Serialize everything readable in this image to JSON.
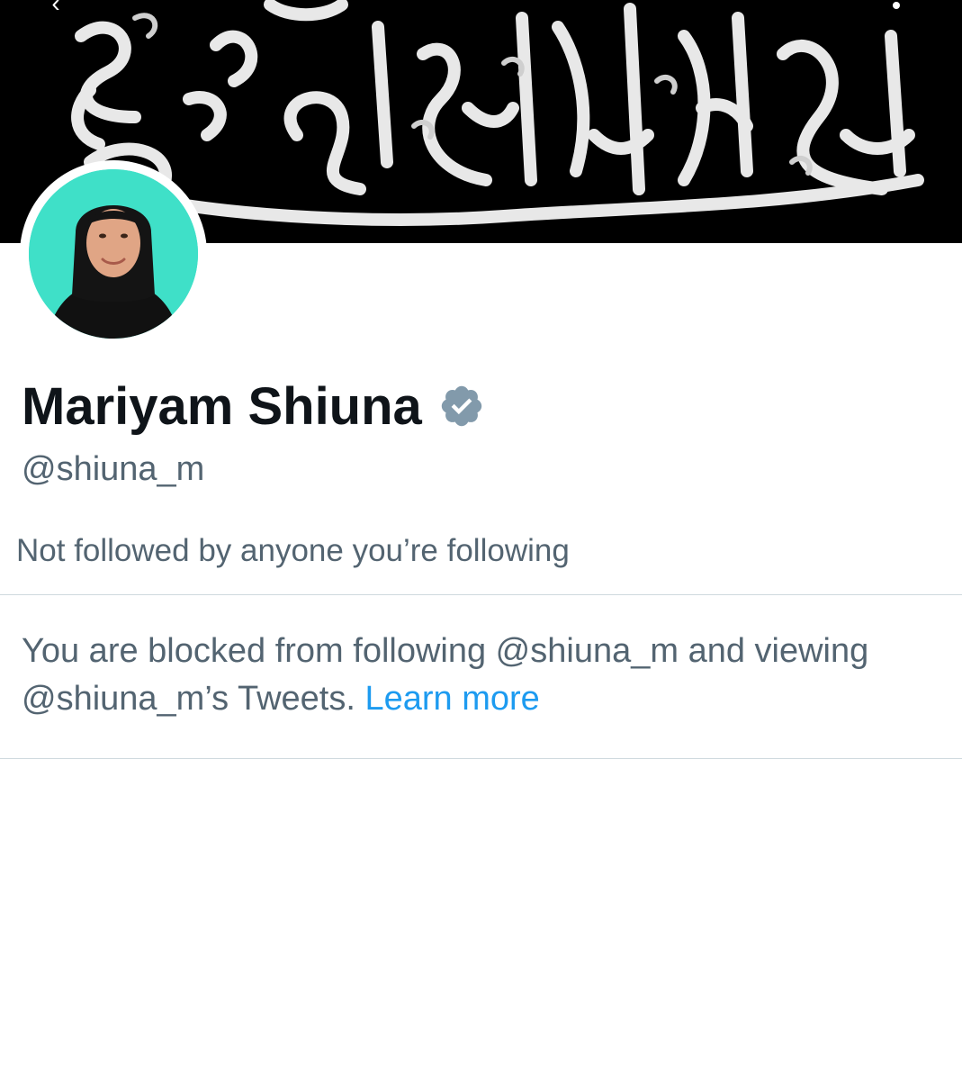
{
  "header": {
    "back_icon": "arrow-left-icon",
    "more_icon": "more-vertical-icon",
    "back_glyph": "‹"
  },
  "banner": {
    "description_color": "#000000",
    "script_color": "#ffffff"
  },
  "profile": {
    "display_name": "Mariyam Shiuna",
    "verified_icon": "verified-badge-icon",
    "verified_color": "#829aab",
    "handle": "@shiuna_m",
    "avatar_bg": "#3fe0c8"
  },
  "social": {
    "followers_note": "Not followed by anyone you’re following"
  },
  "notice": {
    "text": "You are blocked from following @shiuna_m and viewing @shiuna_m’s Tweets. ",
    "link_label": "Learn more",
    "link_color": "#1d9bf0"
  }
}
